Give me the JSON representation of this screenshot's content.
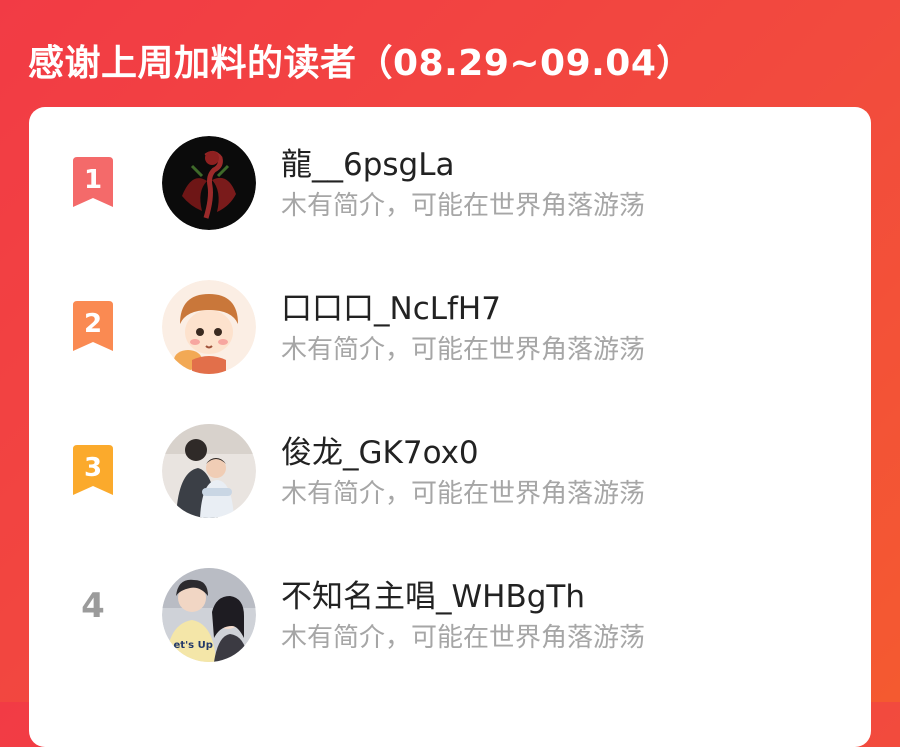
{
  "header": {
    "title": "感谢上周加料的读者（08.29~09.04）"
  },
  "readers": [
    {
      "rank": "1",
      "name": "龍__6psgLa",
      "bio": "木有简介，可能在世界角落游荡",
      "badge_color": "#f46a6a"
    },
    {
      "rank": "2",
      "name": "口口口_NcLfH7",
      "bio": "木有简介，可能在世界角落游荡",
      "badge_color": "#fa8a52"
    },
    {
      "rank": "3",
      "name": "俊龙_GK7ox0",
      "bio": "木有简介，可能在世界角落游荡",
      "badge_color": "#fbaa2c"
    },
    {
      "rank": "4",
      "name": "不知名主唱_WHBgTh",
      "bio": "木有简介，可能在世界角落游荡"
    }
  ],
  "colors": {
    "background": "#f23b45",
    "card": "#ffffff",
    "name_text": "#222222",
    "bio_text": "#a6a6a6",
    "rank_plain": "#9b9b9b"
  }
}
